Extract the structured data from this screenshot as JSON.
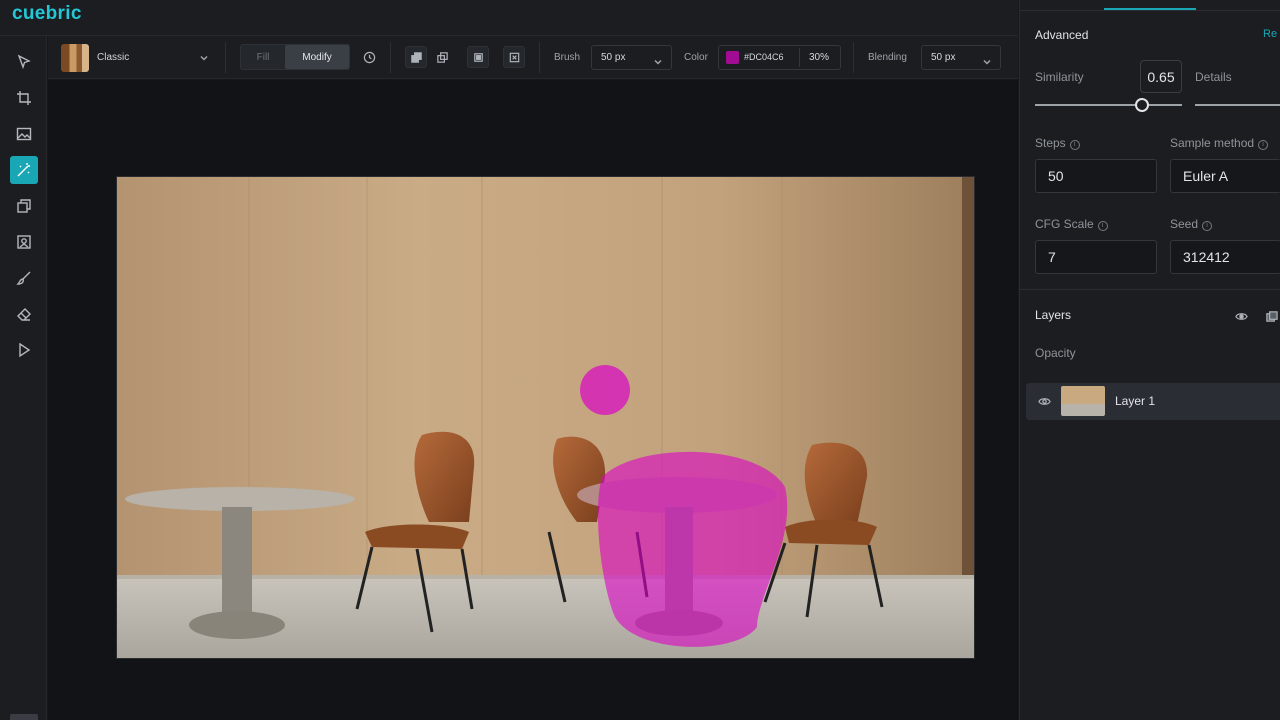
{
  "app": {
    "logo": "cuebric",
    "accent": "#1aa7b5"
  },
  "toolbar": {
    "style_name": "Classic",
    "mode_fill": "Fill",
    "mode_modify": "Modify",
    "brush_label": "Brush",
    "brush_value": "50 px",
    "color_label": "Color",
    "color_hex": "#DC04C6",
    "color_opacity": "30%",
    "blending_label": "Blending",
    "blending_value": "50 px"
  },
  "tools": [
    "select-tool",
    "crop-tool",
    "image-tool",
    "inpaint-tool",
    "layers-tool",
    "replace-tool",
    "brush-tool",
    "eraser-tool",
    "play-tool"
  ],
  "panel": {
    "advanced_title": "Advanced",
    "reset_label": "Re",
    "similarity_label": "Similarity",
    "similarity_value": "0.65",
    "details_label": "Details",
    "steps_label": "Steps",
    "steps_value": "50",
    "sample_method_label": "Sample method",
    "sample_method_value": "Euler A",
    "cfg_label": "CFG Scale",
    "cfg_value": "7",
    "seed_label": "Seed",
    "seed_value": "312412",
    "layers_title": "Layers",
    "opacity_label": "Opacity",
    "layer_name": "Layer 1"
  },
  "mask": {
    "color": "#dc04c6"
  }
}
